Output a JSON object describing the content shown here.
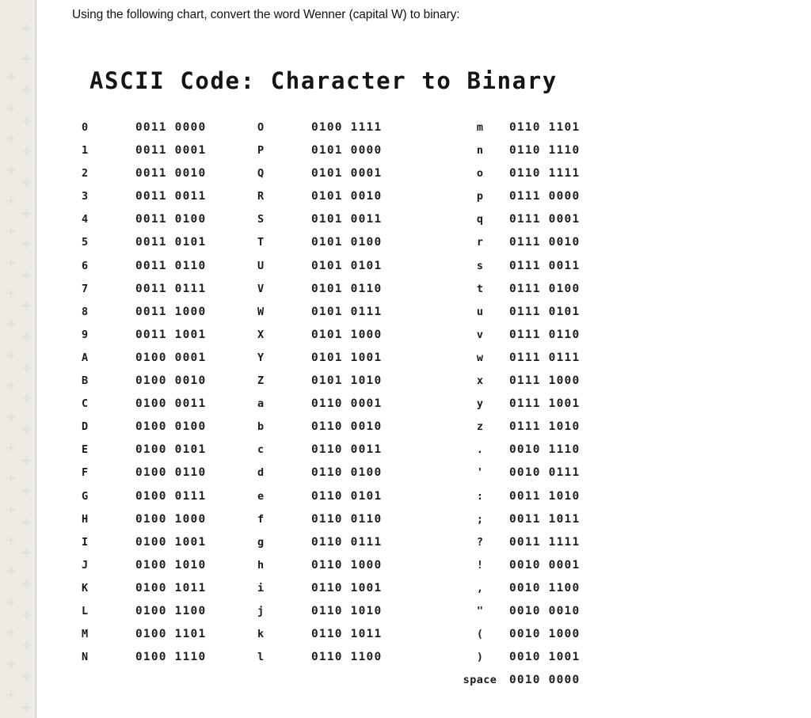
{
  "page": {
    "background_color": "#ffffff",
    "sidebar_color": "#edebe4",
    "text_color": "#151515"
  },
  "prompt": {
    "text": "Using the following chart, convert the word Wenner (capital W) to binary:"
  },
  "chart": {
    "title": "ASCII Code: Character to Binary",
    "columns": [
      {
        "id": "column-1",
        "rows": [
          {
            "character": "0",
            "binary": "0011 0000"
          },
          {
            "character": "1",
            "binary": "0011 0001"
          },
          {
            "character": "2",
            "binary": "0011 0010"
          },
          {
            "character": "3",
            "binary": "0011 0011"
          },
          {
            "character": "4",
            "binary": "0011 0100"
          },
          {
            "character": "5",
            "binary": "0011 0101"
          },
          {
            "character": "6",
            "binary": "0011 0110"
          },
          {
            "character": "7",
            "binary": "0011 0111"
          },
          {
            "character": "8",
            "binary": "0011 1000"
          },
          {
            "character": "9",
            "binary": "0011 1001"
          },
          {
            "character": "A",
            "binary": "0100 0001"
          },
          {
            "character": "B",
            "binary": "0100 0010"
          },
          {
            "character": "C",
            "binary": "0100 0011"
          },
          {
            "character": "D",
            "binary": "0100 0100"
          },
          {
            "character": "E",
            "binary": "0100 0101"
          },
          {
            "character": "F",
            "binary": "0100 0110"
          },
          {
            "character": "G",
            "binary": "0100 0111"
          },
          {
            "character": "H",
            "binary": "0100 1000"
          },
          {
            "character": "I",
            "binary": "0100 1001"
          },
          {
            "character": "J",
            "binary": "0100 1010"
          },
          {
            "character": "K",
            "binary": "0100 1011"
          },
          {
            "character": "L",
            "binary": "0100 1100"
          },
          {
            "character": "M",
            "binary": "0100 1101"
          },
          {
            "character": "N",
            "binary": "0100 1110"
          }
        ]
      },
      {
        "id": "column-2",
        "rows": [
          {
            "character": "O",
            "binary": "0100 1111"
          },
          {
            "character": "P",
            "binary": "0101 0000"
          },
          {
            "character": "Q",
            "binary": "0101 0001"
          },
          {
            "character": "R",
            "binary": "0101 0010"
          },
          {
            "character": "S",
            "binary": "0101 0011"
          },
          {
            "character": "T",
            "binary": "0101 0100"
          },
          {
            "character": "U",
            "binary": "0101 0101"
          },
          {
            "character": "V",
            "binary": "0101 0110"
          },
          {
            "character": "W",
            "binary": "0101 0111"
          },
          {
            "character": "X",
            "binary": "0101 1000"
          },
          {
            "character": "Y",
            "binary": "0101 1001"
          },
          {
            "character": "Z",
            "binary": "0101 1010"
          },
          {
            "character": "a",
            "binary": "0110 0001"
          },
          {
            "character": "b",
            "binary": "0110 0010"
          },
          {
            "character": "c",
            "binary": "0110 0011"
          },
          {
            "character": "d",
            "binary": "0110 0100"
          },
          {
            "character": "e",
            "binary": "0110 0101"
          },
          {
            "character": "f",
            "binary": "0110 0110"
          },
          {
            "character": "g",
            "binary": "0110 0111"
          },
          {
            "character": "h",
            "binary": "0110 1000"
          },
          {
            "character": "i",
            "binary": "0110 1001"
          },
          {
            "character": "j",
            "binary": "0110 1010"
          },
          {
            "character": "k",
            "binary": "0110 1011"
          },
          {
            "character": "l",
            "binary": "0110 1100"
          }
        ]
      },
      {
        "id": "column-3",
        "rows": [
          {
            "character": "m",
            "binary": "0110 1101"
          },
          {
            "character": "n",
            "binary": "0110 1110"
          },
          {
            "character": "o",
            "binary": "0110 1111"
          },
          {
            "character": "p",
            "binary": "0111 0000"
          },
          {
            "character": "q",
            "binary": "0111 0001"
          },
          {
            "character": "r",
            "binary": "0111 0010"
          },
          {
            "character": "s",
            "binary": "0111 0011"
          },
          {
            "character": "t",
            "binary": "0111 0100"
          },
          {
            "character": "u",
            "binary": "0111 0101"
          },
          {
            "character": "v",
            "binary": "0111 0110"
          },
          {
            "character": "w",
            "binary": "0111 0111"
          },
          {
            "character": "x",
            "binary": "0111 1000"
          },
          {
            "character": "y",
            "binary": "0111 1001"
          },
          {
            "character": "z",
            "binary": "0111 1010"
          },
          {
            "character": ".",
            "binary": "0010 1110"
          },
          {
            "character": "'",
            "binary": "0010 0111"
          },
          {
            "character": ":",
            "binary": "0011 1010"
          },
          {
            "character": ";",
            "binary": "0011 1011"
          },
          {
            "character": "?",
            "binary": "0011 1111"
          },
          {
            "character": "!",
            "binary": "0010 0001"
          },
          {
            "character": ",",
            "binary": "0010 1100"
          },
          {
            "character": "\"",
            "binary": "0010 0010"
          },
          {
            "character": "(",
            "binary": "0010 1000"
          },
          {
            "character": ")",
            "binary": "0010 1001"
          },
          {
            "character": "space",
            "binary": "0010 0000"
          }
        ]
      }
    ]
  }
}
